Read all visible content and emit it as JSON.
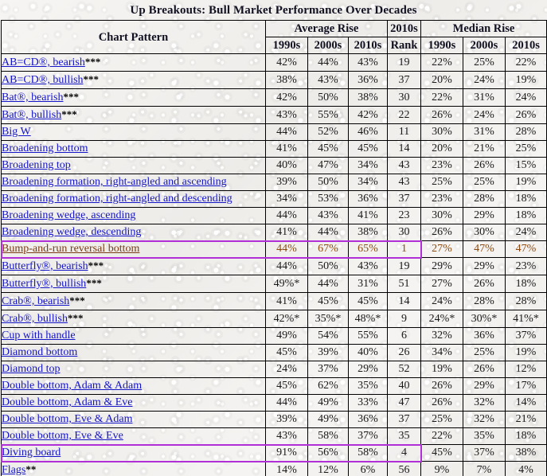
{
  "page": {
    "title": "Up Breakouts: Bull Market Performance Over Decades"
  },
  "table": {
    "group_headers": {
      "pattern": "Chart Pattern",
      "average_rise": "Average Rise",
      "rank_top": "2010s",
      "rank_bottom": "Rank",
      "median_rise": "Median Rise"
    },
    "sub_headers": {
      "avg_1990s": "1990s",
      "avg_2000s": "2000s",
      "avg_2010s": "2010s",
      "med_1990s": "1990s",
      "med_2000s": "2000s",
      "med_2010s": "2010s"
    },
    "rows": [
      {
        "name": "AB=CD®, bearish",
        "marks": "***",
        "avg1990s": "42%",
        "avg2000s": "44%",
        "avg2010s": "43%",
        "rank": "19",
        "med1990s": "22%",
        "med2000s": "25%",
        "med2010s": "22%",
        "highlight": "none"
      },
      {
        "name": "AB=CD®, bullish",
        "marks": "***",
        "avg1990s": "38%",
        "avg2000s": "43%",
        "avg2010s": "36%",
        "rank": "37",
        "med1990s": "20%",
        "med2000s": "24%",
        "med2010s": "19%",
        "highlight": "none"
      },
      {
        "name": "Bat®, bearish",
        "marks": "***",
        "avg1990s": "42%",
        "avg2000s": "50%",
        "avg2010s": "38%",
        "rank": "30",
        "med1990s": "22%",
        "med2000s": "31%",
        "med2010s": "24%",
        "highlight": "none"
      },
      {
        "name": "Bat®, bullish",
        "marks": "***",
        "avg1990s": "43%",
        "avg2000s": "55%",
        "avg2010s": "42%",
        "rank": "22",
        "med1990s": "26%",
        "med2000s": "24%",
        "med2010s": "26%",
        "highlight": "none"
      },
      {
        "name": "Big W",
        "marks": "",
        "avg1990s": "44%",
        "avg2000s": "52%",
        "avg2010s": "46%",
        "rank": "11",
        "med1990s": "30%",
        "med2000s": "31%",
        "med2010s": "28%",
        "highlight": "none"
      },
      {
        "name": "Broadening bottom",
        "marks": "",
        "avg1990s": "41%",
        "avg2000s": "45%",
        "avg2010s": "45%",
        "rank": "14",
        "med1990s": "20%",
        "med2000s": "21%",
        "med2010s": "25%",
        "highlight": "none"
      },
      {
        "name": "Broadening top",
        "marks": "",
        "avg1990s": "40%",
        "avg2000s": "47%",
        "avg2010s": "34%",
        "rank": "43",
        "med1990s": "23%",
        "med2000s": "26%",
        "med2010s": "15%",
        "highlight": "none"
      },
      {
        "name": "Broadening formation, right-angled and ascending",
        "marks": "",
        "avg1990s": "39%",
        "avg2000s": "50%",
        "avg2010s": "34%",
        "rank": "43",
        "med1990s": "25%",
        "med2000s": "25%",
        "med2010s": "19%",
        "highlight": "none"
      },
      {
        "name": "Broadening formation, right-angled and descending",
        "marks": "",
        "avg1990s": "34%",
        "avg2000s": "53%",
        "avg2010s": "36%",
        "rank": "37",
        "med1990s": "23%",
        "med2000s": "28%",
        "med2010s": "18%",
        "highlight": "none"
      },
      {
        "name": "Broadening wedge, ascending",
        "marks": "",
        "avg1990s": "44%",
        "avg2000s": "43%",
        "avg2010s": "41%",
        "rank": "23",
        "med1990s": "30%",
        "med2000s": "29%",
        "med2010s": "18%",
        "highlight": "none"
      },
      {
        "name": "Broadening wedge, descending",
        "marks": "",
        "avg1990s": "41%",
        "avg2000s": "44%",
        "avg2010s": "38%",
        "rank": "30",
        "med1990s": "26%",
        "med2000s": "30%",
        "med2010s": "24%",
        "highlight": "none"
      },
      {
        "name": "Bump-and-run reversal bottom",
        "marks": "",
        "avg1990s": "44%",
        "avg2000s": "67%",
        "avg2010s": "65%",
        "rank": "1",
        "med1990s": "27%",
        "med2000s": "47%",
        "med2010s": "47%",
        "highlight": "boxed-brown"
      },
      {
        "name": "Butterfly®, bearish",
        "marks": "***",
        "avg1990s": "44%",
        "avg2000s": "50%",
        "avg2010s": "43%",
        "rank": "19",
        "med1990s": "29%",
        "med2000s": "29%",
        "med2010s": "23%",
        "highlight": "none"
      },
      {
        "name": "Butterfly®, bullish",
        "marks": "***",
        "avg1990s": "49%*",
        "avg2000s": "44%",
        "avg2010s": "31%",
        "rank": "51",
        "med1990s": "27%",
        "med2000s": "26%",
        "med2010s": "18%",
        "highlight": "none"
      },
      {
        "name": "Crab®, bearish",
        "marks": "***",
        "avg1990s": "41%",
        "avg2000s": "45%",
        "avg2010s": "45%",
        "rank": "14",
        "med1990s": "24%",
        "med2000s": "28%",
        "med2010s": "28%",
        "highlight": "none"
      },
      {
        "name": "Crab®, bullish",
        "marks": "***",
        "avg1990s": "42%*",
        "avg2000s": "35%*",
        "avg2010s": "48%*",
        "rank": "9",
        "med1990s": "24%*",
        "med2000s": "30%*",
        "med2010s": "41%*",
        "highlight": "none"
      },
      {
        "name": "Cup with handle",
        "marks": "",
        "avg1990s": "49%",
        "avg2000s": "54%",
        "avg2010s": "55%",
        "rank": "6",
        "med1990s": "32%",
        "med2000s": "36%",
        "med2010s": "37%",
        "highlight": "none"
      },
      {
        "name": "Diamond bottom",
        "marks": "",
        "avg1990s": "45%",
        "avg2000s": "39%",
        "avg2010s": "40%",
        "rank": "26",
        "med1990s": "34%",
        "med2000s": "25%",
        "med2010s": "19%",
        "highlight": "none"
      },
      {
        "name": "Diamond top",
        "marks": "",
        "avg1990s": "24%",
        "avg2000s": "37%",
        "avg2010s": "29%",
        "rank": "52",
        "med1990s": "19%",
        "med2000s": "26%",
        "med2010s": "12%",
        "highlight": "none"
      },
      {
        "name": "Double bottom, Adam & Adam",
        "marks": "",
        "avg1990s": "45%",
        "avg2000s": "62%",
        "avg2010s": "35%",
        "rank": "40",
        "med1990s": "26%",
        "med2000s": "29%",
        "med2010s": "17%",
        "highlight": "none"
      },
      {
        "name": "Double bottom, Adam & Eve",
        "marks": "",
        "avg1990s": "44%",
        "avg2000s": "49%",
        "avg2010s": "33%",
        "rank": "47",
        "med1990s": "26%",
        "med2000s": "32%",
        "med2010s": "14%",
        "highlight": "none"
      },
      {
        "name": "Double bottom, Eve & Adam",
        "marks": "",
        "avg1990s": "39%",
        "avg2000s": "49%",
        "avg2010s": "36%",
        "rank": "37",
        "med1990s": "25%",
        "med2000s": "32%",
        "med2010s": "21%",
        "highlight": "none"
      },
      {
        "name": "Double bottom, Eve & Eve",
        "marks": "",
        "avg1990s": "43%",
        "avg2000s": "58%",
        "avg2010s": "37%",
        "rank": "35",
        "med1990s": "22%",
        "med2000s": "35%",
        "med2010s": "18%",
        "highlight": "none"
      },
      {
        "name": "Diving board",
        "marks": "",
        "avg1990s": "91%",
        "avg2000s": "56%",
        "avg2010s": "58%",
        "rank": "4",
        "med1990s": "45%",
        "med2000s": "37%",
        "med2010s": "38%",
        "highlight": "boxed-blue"
      },
      {
        "name": "Flags",
        "marks": "**",
        "avg1990s": "14%",
        "avg2000s": "12%",
        "avg2010s": "6%",
        "rank": "56",
        "med1990s": "9%",
        "med2000s": "7%",
        "med2010s": "4%",
        "highlight": "none"
      }
    ]
  },
  "colors": {
    "link": "#1414c8",
    "highlight_border": "#b12fd6",
    "highlight_text": "#7a3a14",
    "title": "#111122",
    "grid": "#000000"
  }
}
